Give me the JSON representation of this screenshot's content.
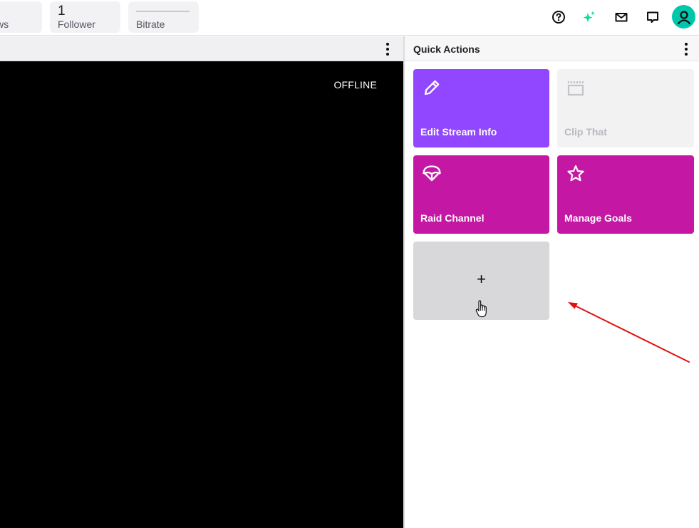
{
  "stats": {
    "views_label": "Views",
    "follower_value": "1",
    "follower_label": "Follower",
    "bitrate_label": "Bitrate"
  },
  "top_icons": [
    "help-icon",
    "sparkle-icon",
    "inbox-icon",
    "whispers-icon",
    "user-avatar-icon"
  ],
  "colors": {
    "purple": "#9147ff",
    "magenta": "#c417a4",
    "avatar": "#00c7ac",
    "sparkle": "#00e290",
    "annotation_arrow": "#e01010"
  },
  "video": {
    "status": "OFFLINE"
  },
  "quick_actions": {
    "title": "Quick Actions",
    "tiles": [
      {
        "label": "Edit Stream Info",
        "icon": "pencil-icon"
      },
      {
        "label": "Clip That",
        "icon": "clapperboard-icon",
        "disabled": true
      },
      {
        "label": "Raid Channel",
        "icon": "parachute-icon"
      },
      {
        "label": "Manage Goals",
        "icon": "star-icon"
      }
    ],
    "add_label": "+"
  }
}
